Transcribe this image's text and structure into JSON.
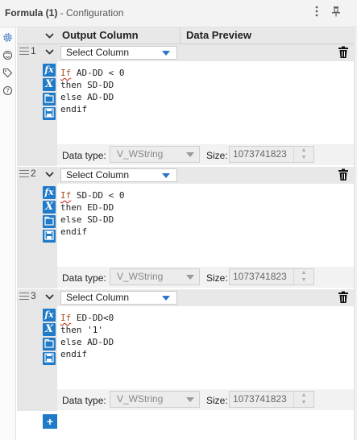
{
  "title": {
    "name": "Formula (1)",
    "sub": " - Configuration"
  },
  "titlebar_icons": [
    "kebab-menu-icon",
    "pin-icon"
  ],
  "sidebar_icons": [
    "gear-icon",
    "workflow-icon",
    "tag-icon",
    "help-icon"
  ],
  "header": {
    "output_column": "Output Column",
    "data_preview": "Data Preview"
  },
  "rows": [
    {
      "num": "1",
      "column": "Select Column",
      "code": {
        "kw": "If",
        "lines": [
          " AD-DD < 0",
          "then SD-DD",
          "else AD-DD",
          "endif"
        ]
      },
      "data_type_label": "Data type:",
      "data_type": "V_WString",
      "size_label": "Size:",
      "size": "1073741823"
    },
    {
      "num": "2",
      "column": "Select Column",
      "code": {
        "kw": "If",
        "lines": [
          " SD-DD < 0",
          "then ED-DD",
          "else SD-DD",
          "endif"
        ]
      },
      "data_type_label": "Data type:",
      "data_type": "V_WString",
      "size_label": "Size:",
      "size": "1073741823"
    },
    {
      "num": "3",
      "column": "Select Column",
      "code": {
        "kw": "If",
        "lines": [
          " ED-DD<0",
          "then '1'",
          "else AD-DD",
          "endif"
        ]
      },
      "data_type_label": "Data type:",
      "data_type": "V_WString",
      "size_label": "Size:",
      "size": "1073741823"
    }
  ],
  "tool_buttons": [
    "fx",
    "X",
    "",
    ""
  ],
  "add_button": "+"
}
